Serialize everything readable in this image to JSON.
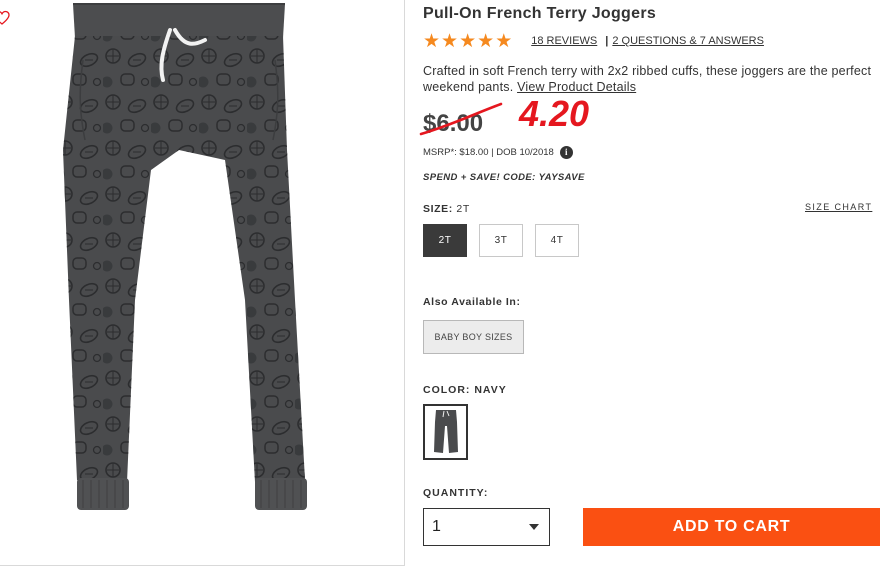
{
  "product": {
    "title": "Pull-On French Terry Joggers",
    "rating_stars": 5,
    "reviews_link": "18 REVIEWS",
    "separator": "|",
    "qa_link": "2 QUESTIONS & 7 ANSWERS",
    "description": "Crafted in soft French terry with 2x2 ribbed cuffs, these joggers are the perfect weekend pants.",
    "details_link": "View Product Details"
  },
  "pricing": {
    "old_price": "$6.00",
    "new_price": "4.20",
    "msrp": "MSRP*: $18.00 | DOB 10/2018",
    "info_icon_glyph": "i",
    "promo": "SPEND + SAVE! CODE: YAYSAVE"
  },
  "size": {
    "label_prefix": "SIZE:",
    "selected": "2T",
    "chart_link": "SIZE CHART",
    "options": [
      "2T",
      "3T",
      "4T"
    ]
  },
  "also_available": {
    "label": "Also Available In:",
    "button": "BABY BOY SIZES"
  },
  "color": {
    "label": "COLOR: NAVY"
  },
  "quantity": {
    "label": "QUANTITY:",
    "value": "1"
  },
  "cart": {
    "button": "ADD TO CART"
  },
  "icons": {
    "favorite": "heart-outline-icon",
    "star": "star-icon",
    "info": "info-icon",
    "dropdown": "chevron-down-icon"
  },
  "colors": {
    "star": "#f5891f",
    "new_price": "#e5171f",
    "strike": "#e5171f",
    "cta": "#fa5012",
    "selected_size": "#3a3a3a",
    "pants": "#4a4b4d"
  }
}
